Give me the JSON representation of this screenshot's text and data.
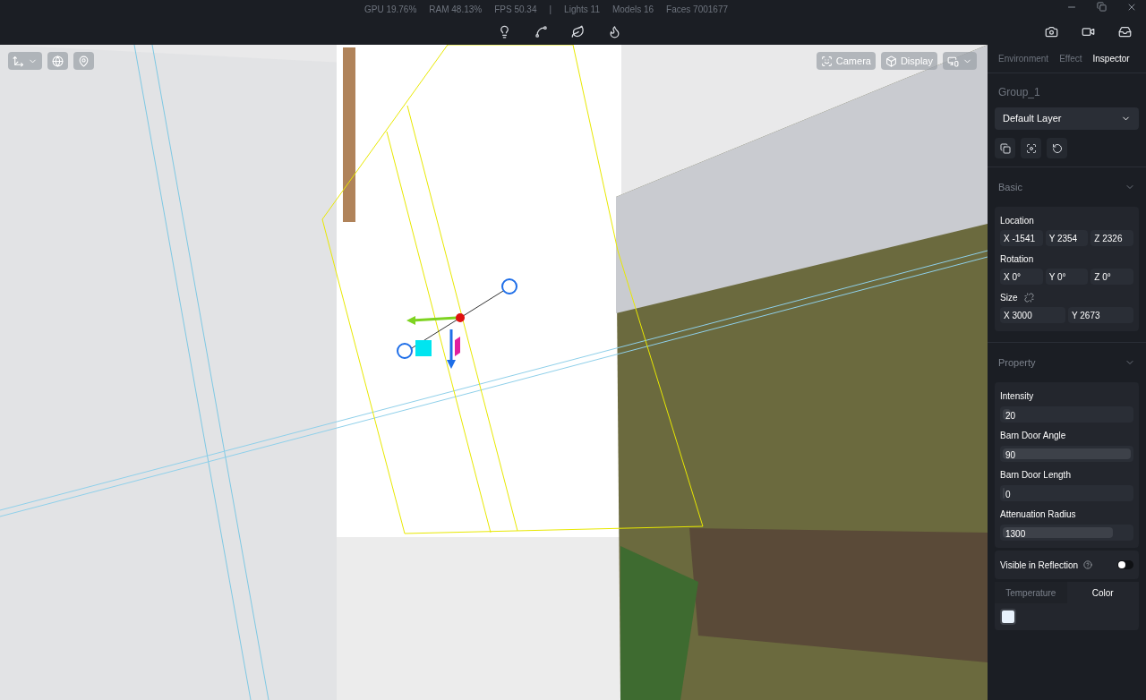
{
  "stats": [
    "GPU 19.76%",
    "RAM 48.13%",
    "FPS 50.34",
    "|",
    "Lights 11",
    "Models 16",
    "Faces 7001677"
  ],
  "toolbar_icons": [
    {
      "kind": "bulb"
    },
    {
      "kind": "connector"
    },
    {
      "kind": "leaf"
    },
    {
      "kind": "flame"
    }
  ],
  "viewport": {
    "left_tools": [
      {
        "kind": "transform",
        "caret": true
      },
      {
        "kind": "globe"
      },
      {
        "kind": "pin"
      }
    ],
    "right_tools": [
      {
        "kind": "camera",
        "label": "Camera"
      },
      {
        "kind": "display",
        "label": "Display"
      },
      {
        "kind": "view",
        "caret": true
      }
    ]
  },
  "panel_tabs": [
    {
      "label": "Environment",
      "selected": false
    },
    {
      "label": "Effect",
      "selected": false
    },
    {
      "label": "Inspector",
      "selected": true
    }
  ],
  "object_name": "Group_1",
  "layer_select": {
    "value": "Default Layer"
  },
  "basic": {
    "title": "Basic",
    "expanded": true,
    "groups": [
      {
        "label": "Location",
        "fields": [
          "X -1541",
          "Y 2354",
          "Z 2326"
        ]
      },
      {
        "label": "Rotation",
        "fields": [
          "X 0°",
          "Y 0°",
          "Z 0°"
        ]
      },
      {
        "label": "Size",
        "unlink": true,
        "fields": [
          "X 3000",
          "Y 2673"
        ]
      }
    ]
  },
  "property": {
    "title": "Property",
    "expanded": true,
    "sliders": [
      {
        "label": "Intensity",
        "value": "20",
        "level": 0.06
      },
      {
        "label": "Barn Door Angle",
        "value": "90",
        "level": 1
      },
      {
        "label": "Barn Door Length",
        "value": "0",
        "level": 0
      },
      {
        "label": "Attenuation Radius",
        "value": "1300",
        "level": 0.86
      }
    ],
    "toggle": {
      "label": "Visible in Reflection",
      "on": false
    },
    "color_tabs": [
      {
        "label": "Temperature",
        "selected": false
      },
      {
        "label": "Color",
        "selected": true
      }
    ],
    "swatch": {
      "color": "#e8f2fc"
    }
  }
}
